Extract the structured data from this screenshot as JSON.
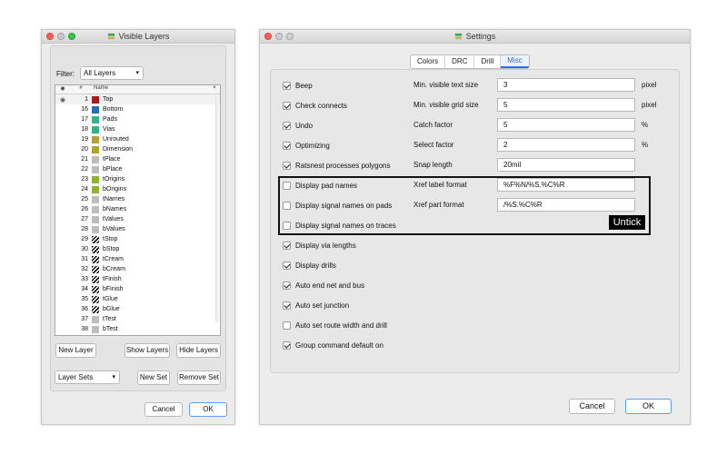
{
  "visible_layers": {
    "title": "Visible Layers",
    "filter_label": "Filter:",
    "filter_value": "All Layers",
    "columns": {
      "eye": "◉",
      "num": "#",
      "name": "Name",
      "close": "×"
    },
    "layers": [
      {
        "num": "1",
        "name": "Top",
        "color": "#b01717",
        "visible": true,
        "pattern": "solid"
      },
      {
        "num": "16",
        "name": "Bottom",
        "color": "#1e6fc4",
        "visible": false,
        "pattern": "solid"
      },
      {
        "num": "17",
        "name": "Pads",
        "color": "#2fb58a",
        "visible": false,
        "pattern": "solid"
      },
      {
        "num": "18",
        "name": "Vias",
        "color": "#2fb58a",
        "visible": false,
        "pattern": "solid"
      },
      {
        "num": "19",
        "name": "Unrouted",
        "color": "#b6a32c",
        "visible": false,
        "pattern": "solid"
      },
      {
        "num": "20",
        "name": "Dimension",
        "color": "#b6a32c",
        "visible": false,
        "pattern": "solid"
      },
      {
        "num": "21",
        "name": "tPlace",
        "color": "#bdbdbd",
        "visible": false,
        "pattern": "solid"
      },
      {
        "num": "22",
        "name": "bPlace",
        "color": "#bdbdbd",
        "visible": false,
        "pattern": "solid"
      },
      {
        "num": "23",
        "name": "tOrigins",
        "color": "#8fb52a",
        "visible": false,
        "pattern": "solid"
      },
      {
        "num": "24",
        "name": "bOrigins",
        "color": "#8fb52a",
        "visible": false,
        "pattern": "solid"
      },
      {
        "num": "25",
        "name": "tNames",
        "color": "#bdbdbd",
        "visible": false,
        "pattern": "solid"
      },
      {
        "num": "26",
        "name": "bNames",
        "color": "#bdbdbd",
        "visible": false,
        "pattern": "solid"
      },
      {
        "num": "27",
        "name": "tValues",
        "color": "#bdbdbd",
        "visible": false,
        "pattern": "solid"
      },
      {
        "num": "28",
        "name": "bValues",
        "color": "#bdbdbd",
        "visible": false,
        "pattern": "solid"
      },
      {
        "num": "29",
        "name": "tStop",
        "color": "#111111",
        "visible": false,
        "pattern": "hatch"
      },
      {
        "num": "30",
        "name": "bStop",
        "color": "#111111",
        "visible": false,
        "pattern": "hatch"
      },
      {
        "num": "31",
        "name": "tCream",
        "color": "#111111",
        "visible": false,
        "pattern": "hatch"
      },
      {
        "num": "32",
        "name": "bCream",
        "color": "#111111",
        "visible": false,
        "pattern": "hatch"
      },
      {
        "num": "33",
        "name": "tFinish",
        "color": "#111111",
        "visible": false,
        "pattern": "hatch"
      },
      {
        "num": "34",
        "name": "bFinish",
        "color": "#111111",
        "visible": false,
        "pattern": "hatch"
      },
      {
        "num": "35",
        "name": "tGlue",
        "color": "#111111",
        "visible": false,
        "pattern": "hatch"
      },
      {
        "num": "36",
        "name": "bGlue",
        "color": "#111111",
        "visible": false,
        "pattern": "hatch"
      },
      {
        "num": "37",
        "name": "tTest",
        "color": "#bdbdbd",
        "visible": false,
        "pattern": "solid"
      },
      {
        "num": "38",
        "name": "bTest",
        "color": "#bdbdbd",
        "visible": false,
        "pattern": "solid"
      }
    ],
    "buttons": {
      "new_layer": "New Layer",
      "show_layers": "Show Layers",
      "hide_layers": "Hide Layers",
      "layer_sets": "Layer Sets",
      "new_set": "New Set",
      "remove_set": "Remove Set",
      "cancel": "Cancel",
      "ok": "OK"
    }
  },
  "settings": {
    "title": "Settings",
    "tabs": [
      {
        "label": "Colors",
        "active": false
      },
      {
        "label": "DRC",
        "active": false
      },
      {
        "label": "Drill",
        "active": false
      },
      {
        "label": "Misc",
        "active": true
      }
    ],
    "options": [
      {
        "label": "Beep",
        "checked": true
      },
      {
        "label": "Check connects",
        "checked": true
      },
      {
        "label": "Undo",
        "checked": true
      },
      {
        "label": "Optimizing",
        "checked": true
      },
      {
        "label": "Ratsnest processes polygons",
        "checked": true
      },
      {
        "label": "Display pad names",
        "checked": false
      },
      {
        "label": "Display signal names on pads",
        "checked": false
      },
      {
        "label": "Display signal names on traces",
        "checked": false
      },
      {
        "label": "Display via lengths",
        "checked": true
      },
      {
        "label": "Display drills",
        "checked": true
      },
      {
        "label": "Auto end net and bus",
        "checked": true
      },
      {
        "label": "Auto set junction",
        "checked": true
      },
      {
        "label": "Auto set route width and drill",
        "checked": false
      },
      {
        "label": "Group command default on",
        "checked": true
      }
    ],
    "fields": [
      {
        "label": "Min. visible text size",
        "value": "3",
        "unit": "pixel"
      },
      {
        "label": "Min. visible grid size",
        "value": "5",
        "unit": "pixel"
      },
      {
        "label": "Catch factor",
        "value": "5",
        "unit": "%"
      },
      {
        "label": "Select factor",
        "value": "2",
        "unit": "%"
      },
      {
        "label": "Snap length",
        "value": "20mil",
        "unit": ""
      },
      {
        "label": "Xref label format",
        "value": "%F%N/%S.%C%R",
        "unit": ""
      },
      {
        "label": "Xref part format",
        "value": "/%S.%C%R",
        "unit": ""
      }
    ],
    "annotation": "Untick",
    "buttons": {
      "cancel": "Cancel",
      "ok": "OK"
    }
  }
}
